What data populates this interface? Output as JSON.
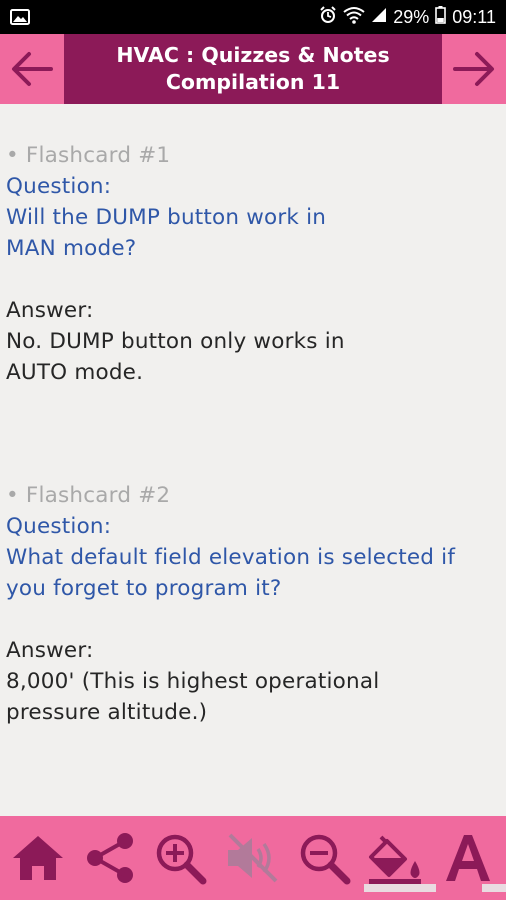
{
  "status": {
    "battery": "29%",
    "time": "09:11"
  },
  "header": {
    "title_line1": "HVAC : Quizzes & Notes",
    "title_line2": "Compilation 11",
    "back_icon": "arrow-left-icon",
    "forward_icon": "arrow-right-icon"
  },
  "flashcards": [
    {
      "label": "• Flashcard #1",
      "question_label": "Question:",
      "question_lines": [
        "Will the DUMP button work in",
        "MAN mode?"
      ],
      "answer_label": "Answer:",
      "answer_lines": [
        "No. DUMP button only works in",
        "AUTO mode."
      ]
    },
    {
      "label": "• Flashcard #2",
      "question_label": "Question:",
      "question_lines": [
        "What default field elevation is selected if",
        "you forget to program it?"
      ],
      "answer_label": "Answer:",
      "answer_lines": [
        "8,000' (This is highest operational",
        "pressure altitude.)"
      ]
    }
  ],
  "toolbar": {
    "buttons": [
      "home-icon",
      "share-icon",
      "zoom-in-icon",
      "sound-off-icon",
      "zoom-out-icon",
      "paint-bucket-icon",
      "font-icon"
    ]
  },
  "colors": {
    "accent": "#f06a9e",
    "header_dark": "#8c1a58",
    "question": "#2f57a8",
    "toolbar_icon": "#8c1a58"
  }
}
